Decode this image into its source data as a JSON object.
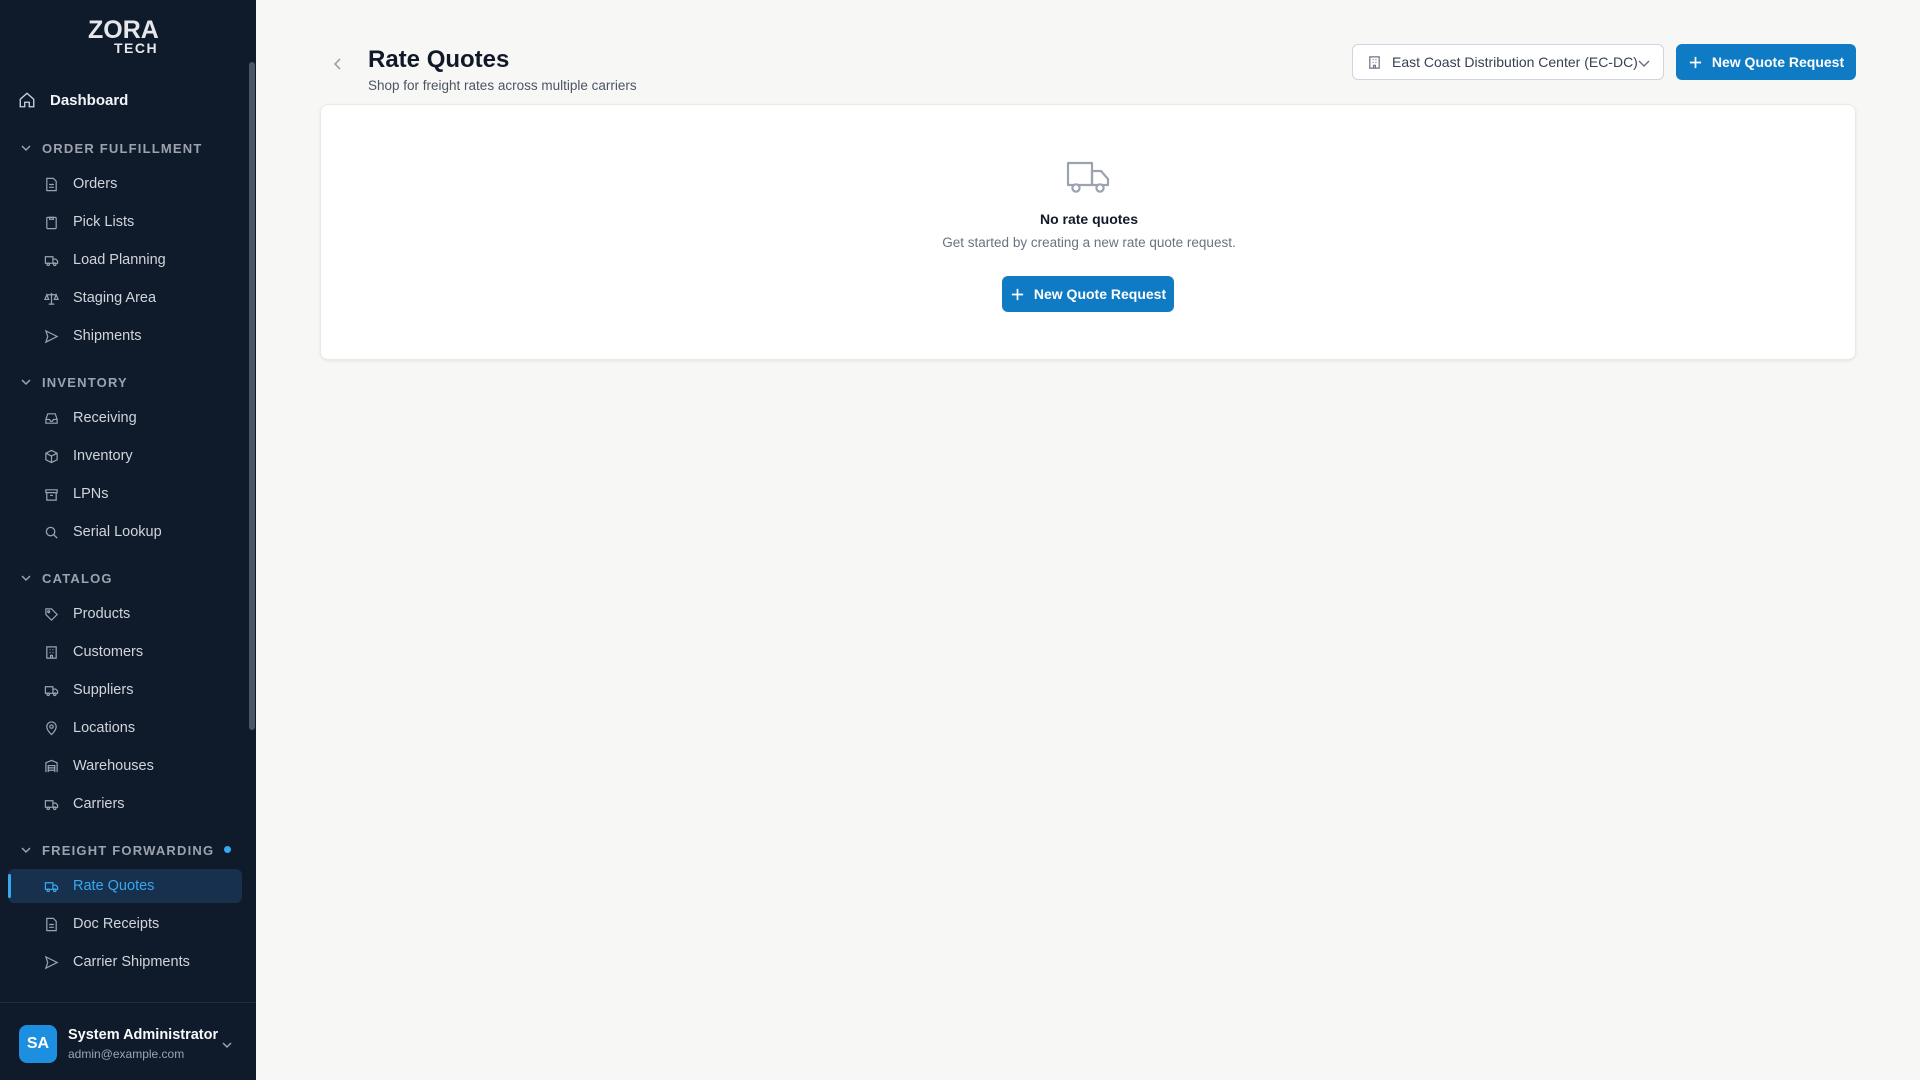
{
  "brand": {
    "logo_top": "ZORA",
    "logo_bottom": "TECH"
  },
  "sidebar": {
    "dashboard": "Dashboard",
    "sections": [
      {
        "title": "ORDER FULFILLMENT",
        "items": [
          "Orders",
          "Pick Lists",
          "Load Planning",
          "Staging Area",
          "Shipments"
        ]
      },
      {
        "title": "INVENTORY",
        "items": [
          "Receiving",
          "Inventory",
          "LPNs",
          "Serial Lookup"
        ]
      },
      {
        "title": "CATALOG",
        "items": [
          "Products",
          "Customers",
          "Suppliers",
          "Locations",
          "Warehouses",
          "Carriers"
        ]
      },
      {
        "title": "FREIGHT FORWARDING",
        "items": [
          "Rate Quotes",
          "Doc Receipts",
          "Carrier Shipments"
        ]
      }
    ],
    "active_item": "Rate Quotes"
  },
  "user": {
    "initials": "SA",
    "name": "System Administrator",
    "email": "admin@example.com"
  },
  "header": {
    "title": "Rate Quotes",
    "subtitle": "Shop for freight rates across multiple carriers",
    "warehouse_selected": "East Coast Distribution Center (EC-DC)",
    "new_button": "New Quote Request"
  },
  "empty_state": {
    "title": "No rate quotes",
    "description": "Get started by creating a new rate quote request.",
    "button": "New Quote Request"
  },
  "colors": {
    "sidebar_bg": "#0f1a2b",
    "accent": "#0f7bc4",
    "active_text": "#38a9f0"
  }
}
